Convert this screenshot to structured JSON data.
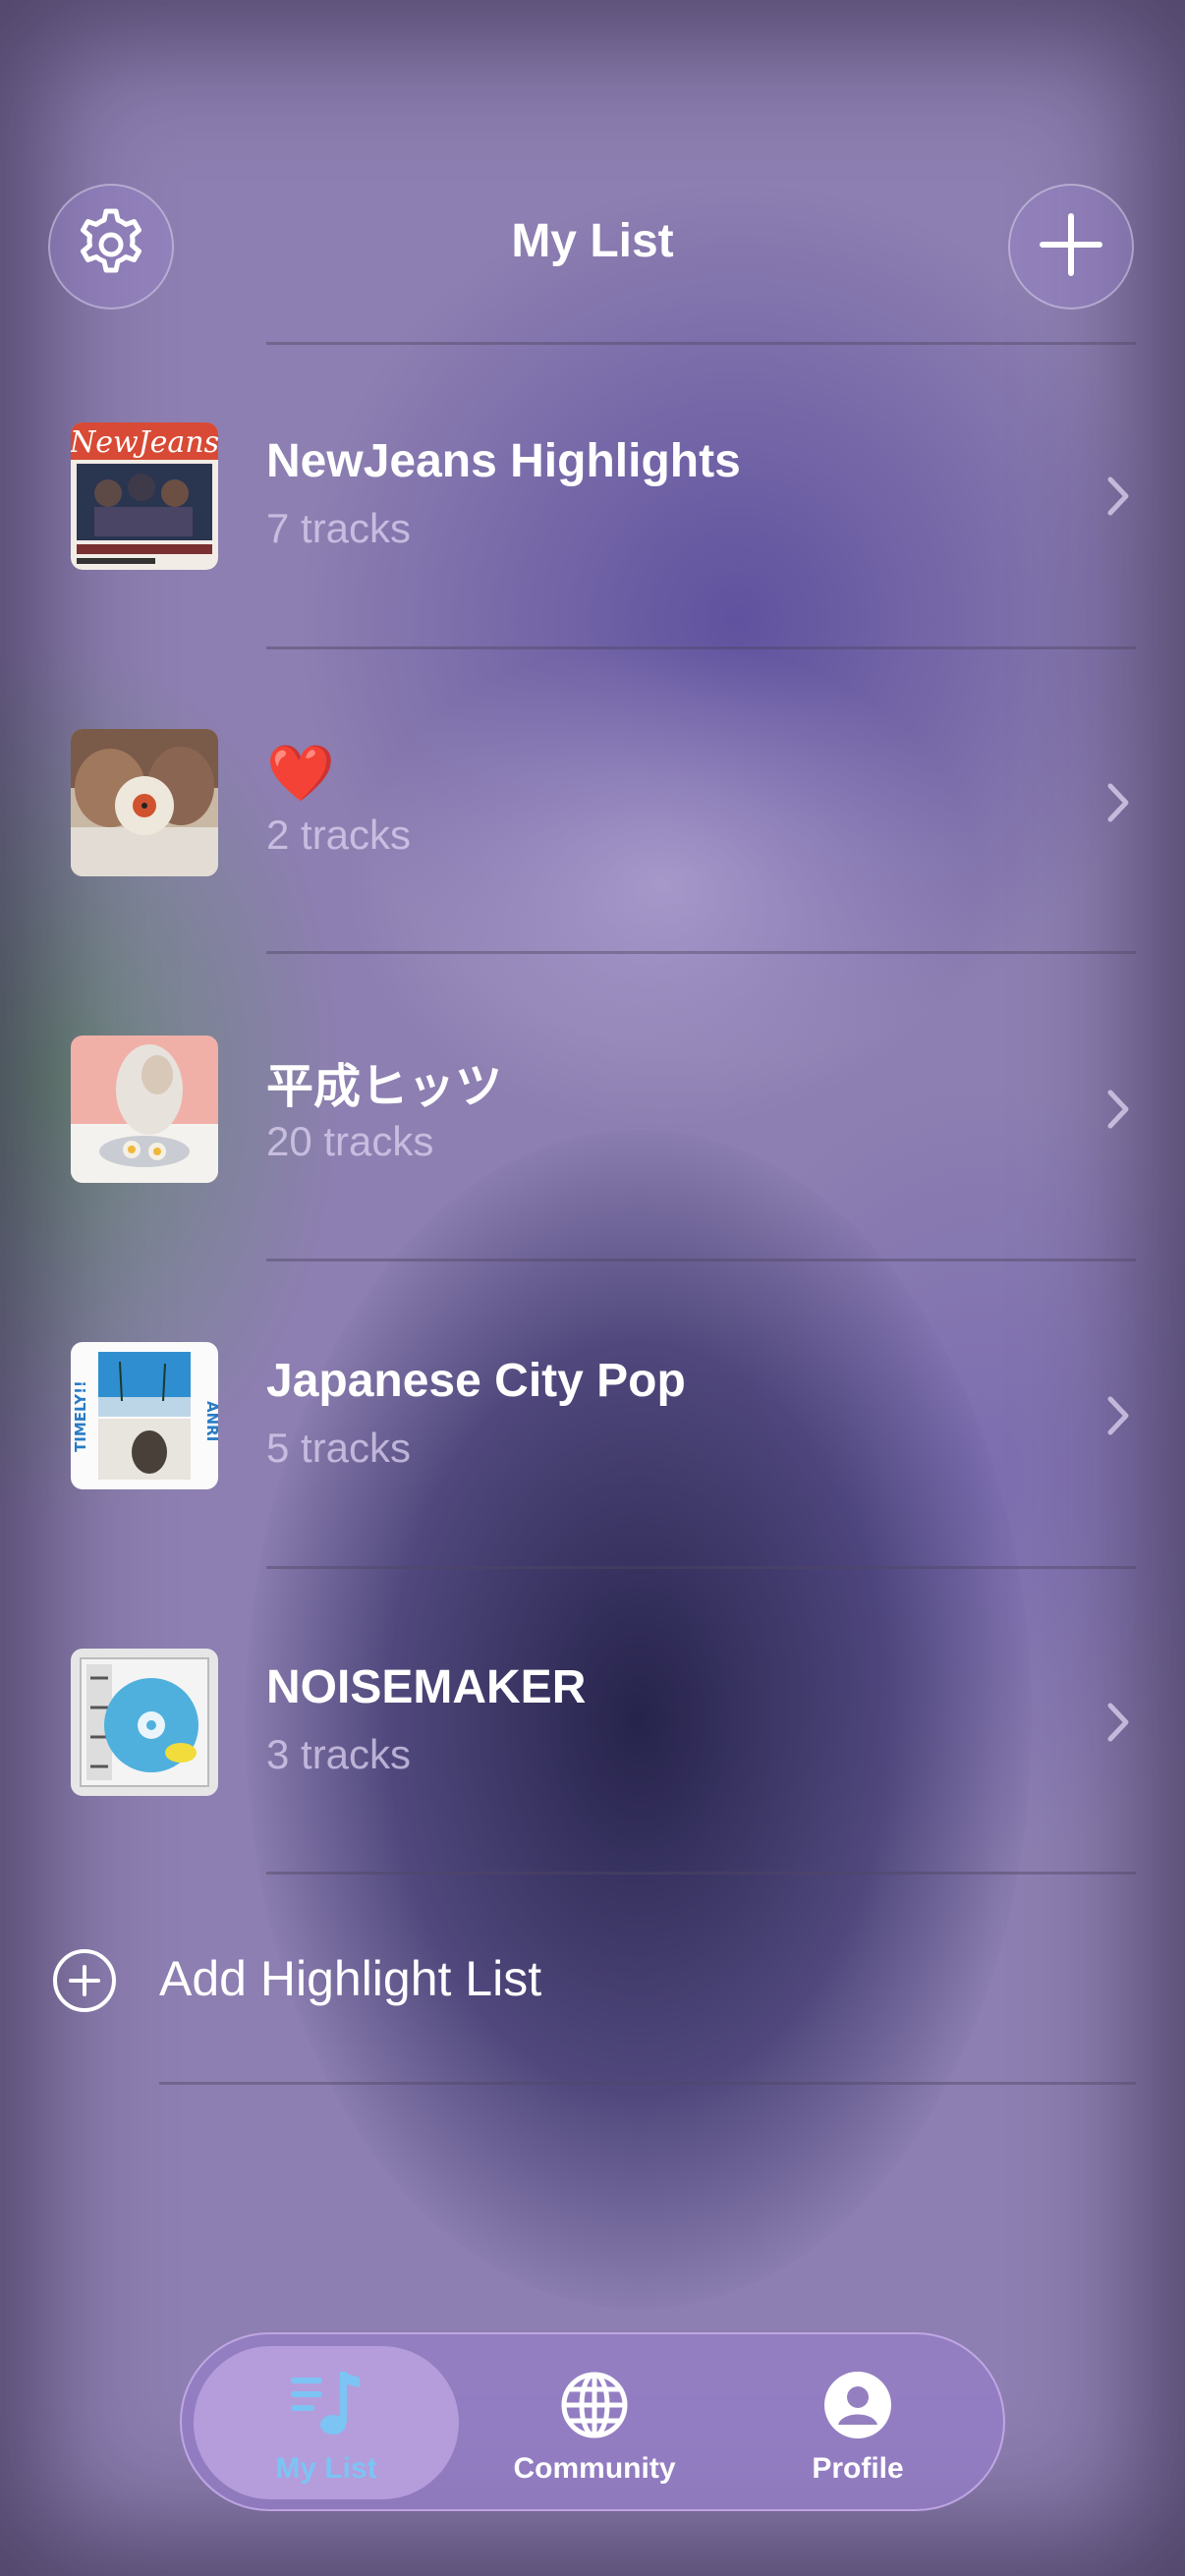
{
  "header": {
    "title": "My List",
    "settings_icon": "gear-icon",
    "add_icon": "plus-icon"
  },
  "lists": [
    {
      "title": "NewJeans Highlights",
      "subtitle": "7 tracks",
      "art": "NewJeans"
    },
    {
      "title": "❤️",
      "subtitle": "2 tracks",
      "art": ""
    },
    {
      "title": "平成ヒッツ",
      "subtitle": "20 tracks",
      "art": ""
    },
    {
      "title": "Japanese City Pop",
      "subtitle": "5 tracks",
      "art": "ANRI"
    },
    {
      "title": "NOISEMAKER",
      "subtitle": "3 tracks",
      "art": ""
    }
  ],
  "add_list": {
    "label": "Add Highlight List",
    "icon": "plus-circle-icon"
  },
  "tabbar": {
    "tabs": [
      {
        "label": "My List",
        "icon": "music-list-icon",
        "active": true
      },
      {
        "label": "Community",
        "icon": "globe-icon",
        "active": false
      },
      {
        "label": "Profile",
        "icon": "person-icon",
        "active": false
      }
    ],
    "active_color": "#7cc4f4"
  }
}
